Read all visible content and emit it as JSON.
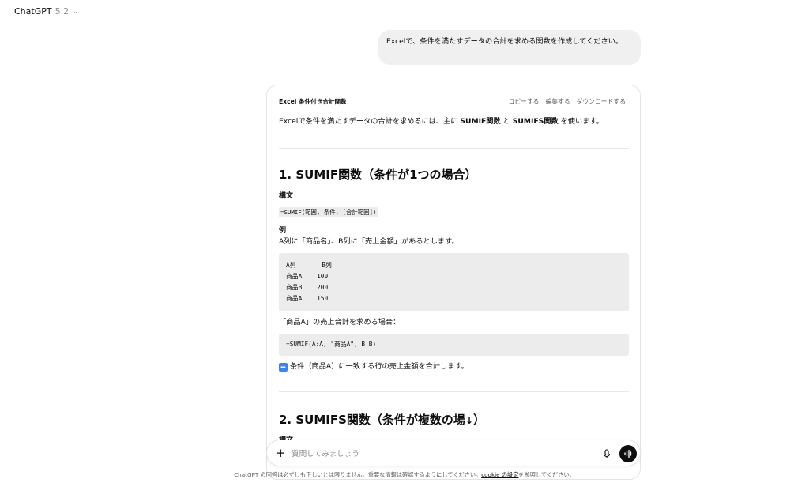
{
  "header": {
    "title": "ChatGPT",
    "version": "5.2"
  },
  "user_message": "Excelで、条件を満たすデータの合計を求める関数を作成してください。",
  "canvas": {
    "title": "Excel 条件付き合計関数",
    "actions": {
      "copy": "コピーする",
      "edit": "編集する",
      "download": "ダウンロードする"
    }
  },
  "doc": {
    "intro": {
      "before": "Excelで条件を満たすデータの合計を求めるには、主に ",
      "b1": "SUMIF関数",
      "mid": " と ",
      "b2": "SUMIFS関数",
      "after": " を使います。"
    },
    "section1": {
      "heading": "1. SUMIF関数（条件が1つの場合）",
      "syntax_label": "構文",
      "syntax_code": "=SUMIF(範囲, 条件, [合計範囲])",
      "example_label": "例",
      "example_text": "A列に「商品名」、B列に「売上金額」があるとします。",
      "table_code": "A列       B列\n商品A    100\n商品B    200\n商品A    150",
      "case_text": "「商品A」の売上合計を求める場合：",
      "formula_code": "=SUMIF(A:A, \"商品A\", B:B)",
      "result_text": "条件（商品A）に一致する行の売上金額を合計します。"
    },
    "section2": {
      "heading": "2. SUMIFS関数（条件が複数の場",
      "heading_end": "）",
      "next_label": "構文"
    }
  },
  "composer": {
    "placeholder": "質問してみましょう"
  },
  "footer": {
    "before": "ChatGPT の回答は必ずしも正しいとは限りません。重要な情報は確認するようにしてください。",
    "link": "cookie の設定",
    "after": "を参照してください。"
  }
}
